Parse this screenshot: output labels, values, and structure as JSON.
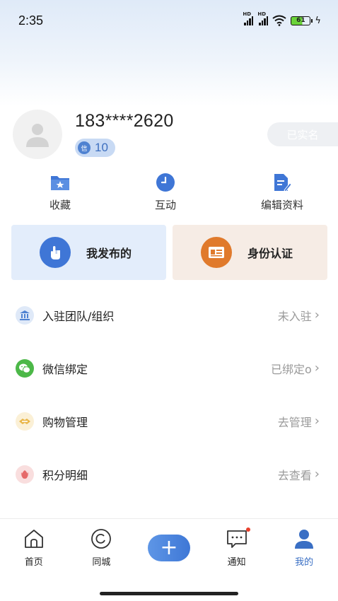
{
  "status_bar": {
    "time": "2:35",
    "battery": "61"
  },
  "profile": {
    "phone": "183****2620",
    "credit_icon_text": "信",
    "credit_score": "10",
    "verified_label": "已实名"
  },
  "quick_actions": [
    {
      "label": "收藏",
      "icon": "folder-star-icon"
    },
    {
      "label": "互动",
      "icon": "clock-icon"
    },
    {
      "label": "编辑资料",
      "icon": "edit-document-icon"
    }
  ],
  "cards": [
    {
      "label": "我发布的",
      "icon": "hand-tap-icon",
      "color": "#3f76d6"
    },
    {
      "label": "身份认证",
      "icon": "id-card-icon",
      "color": "#e07a2c"
    }
  ],
  "menu": [
    {
      "label": "入驻团队/组织",
      "value": "未入驻",
      "icon": "bank-icon",
      "color": "#4f82d1"
    },
    {
      "label": "微信绑定",
      "value": "已绑定o",
      "icon": "wechat-icon",
      "color": "#4cb848"
    },
    {
      "label": "购物管理",
      "value": "去管理",
      "icon": "shopping-icon",
      "color": "#e9b649"
    },
    {
      "label": "积分明细",
      "value": "去查看",
      "icon": "points-icon",
      "color": "#e56a6a"
    }
  ],
  "tabbar": [
    {
      "label": "首页",
      "icon": "home-icon"
    },
    {
      "label": "同城",
      "icon": "location-circle-icon"
    },
    {
      "label": "",
      "icon": "plus-icon",
      "symbol": "+"
    },
    {
      "label": "通知",
      "icon": "message-icon"
    },
    {
      "label": "我的",
      "icon": "user-icon",
      "active": true
    }
  ],
  "accent_color": "#3a6fc4"
}
